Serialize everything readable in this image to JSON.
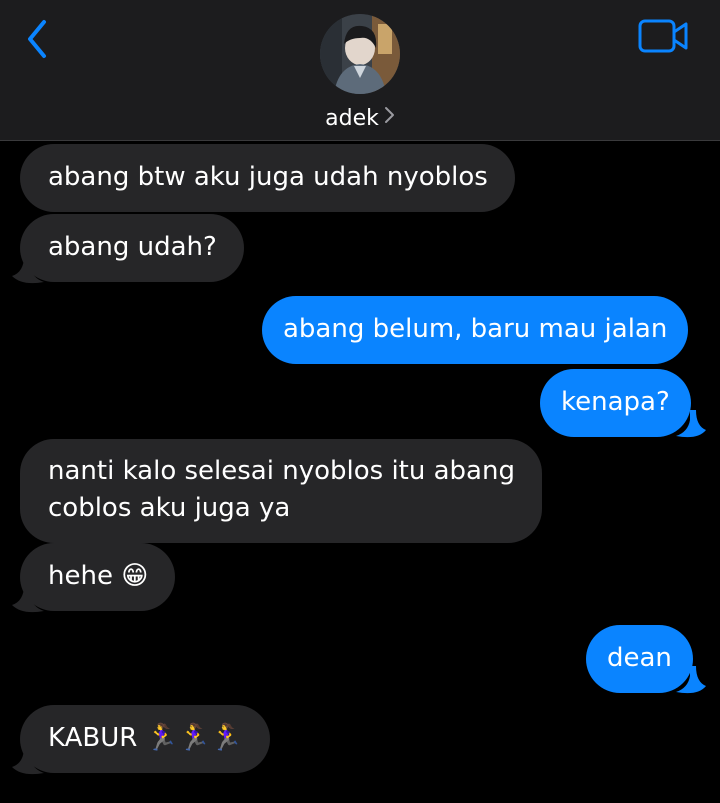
{
  "header": {
    "contact_name": "adek",
    "back_icon": "chevron-left-icon",
    "video_icon": "video-camera-icon",
    "accent_color": "#0a84ff"
  },
  "messages": [
    {
      "direction": "incoming",
      "text": "abang btw aku juga udah nyoblos"
    },
    {
      "direction": "incoming",
      "text": "abang udah?"
    },
    {
      "direction": "outgoing",
      "text": "abang belum, baru mau jalan"
    },
    {
      "direction": "outgoing",
      "text": "kenapa?"
    },
    {
      "direction": "incoming",
      "lines": [
        "nanti kalo selesai nyoblos itu abang",
        "coblos aku juga ya"
      ]
    },
    {
      "direction": "incoming",
      "text": "hehe",
      "emoji": "😁"
    },
    {
      "direction": "outgoing",
      "text": "dean"
    },
    {
      "direction": "incoming",
      "text": "KABUR",
      "emoji": "🏃‍♀️🏃‍♀️🏃‍♀️"
    }
  ],
  "colors": {
    "incoming_bubble": "#262628",
    "outgoing_bubble": "#0a84ff",
    "background": "#000000",
    "header_background": "#1c1c1e"
  }
}
